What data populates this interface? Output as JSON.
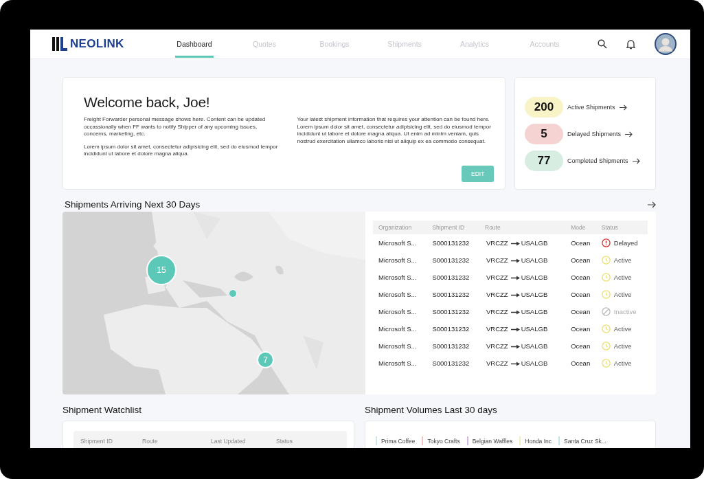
{
  "logo": {
    "text": "NEOLINK"
  },
  "nav": {
    "tabs": [
      {
        "label": "Dashboard",
        "selected": true
      },
      {
        "label": "Quotes",
        "selected": false
      },
      {
        "label": "Bookings",
        "selected": false
      },
      {
        "label": "Shipments",
        "selected": false
      },
      {
        "label": "Analytics",
        "selected": false
      },
      {
        "label": "Accounts",
        "selected": false
      }
    ]
  },
  "welcome": {
    "title": "Welcome back, Joe!",
    "paragraphs_left": [
      "Freight Forwarder personal message shows here. Content can be updated occassionally when FF wants to notify Shipper of any upcoming issues, concerns, marketing, etc.",
      "Lorem ipsum dolor sit amet, consectetur adipisicing elit, sed do eiusmod tempor incididunt ut labore et dolore magna aliqua."
    ],
    "paragraph_right": "Your latest shipment information that requires your attention can be found here. Lorem ipsum dolor sit amet, consectetur adipisicing elit, sed do eiusmod tempor incididunt ut labore et dolore magna aliqua. Ut enim ad minim veniam, quis nostrud exercitation ullamco laboris nisi ut aliquip ex ea commodo consequat.",
    "button": "EDIT"
  },
  "stats": [
    {
      "count": "200",
      "label": "Active Shipments",
      "color": "#f8f4c8"
    },
    {
      "count": "5",
      "label": "Delayed Shipments",
      "color": "#f6d3d3"
    },
    {
      "count": "77",
      "label": "Completed Shipments",
      "color": "#d8ede1"
    }
  ],
  "arrivals": {
    "title": "Shipments Arriving Next 30 Days",
    "map": {
      "markers": [
        {
          "label": "15",
          "kind": "cluster"
        },
        {
          "kind": "point"
        },
        {
          "label": "7",
          "kind": "cluster"
        }
      ]
    },
    "table": {
      "columns": [
        "Organization",
        "Shipment ID",
        "Route",
        "Mode",
        "Status"
      ],
      "rows": [
        {
          "organization": "Microsoft S...",
          "shipment_id": "S000131232",
          "origin": "VRCZZ",
          "destination": "USALGB",
          "mode": "Ocean",
          "status": "Delayed",
          "kind": "delayed"
        },
        {
          "organization": "Microsoft S...",
          "shipment_id": "S000131232",
          "origin": "VRCZZ",
          "destination": "USALGB",
          "mode": "Ocean",
          "status": "Active",
          "kind": "active"
        },
        {
          "organization": "Microsoft S...",
          "shipment_id": "S000131232",
          "origin": "VRCZZ",
          "destination": "USALGB",
          "mode": "Ocean",
          "status": "Active",
          "kind": "active"
        },
        {
          "organization": "Microsoft S...",
          "shipment_id": "S000131232",
          "origin": "VRCZZ",
          "destination": "USALGB",
          "mode": "Ocean",
          "status": "Active",
          "kind": "active"
        },
        {
          "organization": "Microsoft S...",
          "shipment_id": "S000131232",
          "origin": "VRCZZ",
          "destination": "USALGB",
          "mode": "Ocean",
          "status": "Inactive",
          "kind": "inactive"
        },
        {
          "organization": "Microsoft S...",
          "shipment_id": "S000131232",
          "origin": "VRCZZ",
          "destination": "USALGB",
          "mode": "Ocean",
          "status": "Active",
          "kind": "active"
        },
        {
          "organization": "Microsoft S...",
          "shipment_id": "S000131232",
          "origin": "VRCZZ",
          "destination": "USALGB",
          "mode": "Ocean",
          "status": "Active",
          "kind": "active"
        },
        {
          "organization": "Microsoft S...",
          "shipment_id": "S000131232",
          "origin": "VRCZZ",
          "destination": "USALGB",
          "mode": "Ocean",
          "status": "Active",
          "kind": "active"
        }
      ]
    }
  },
  "watchlist": {
    "title": "Shipment Watchlist",
    "columns": [
      "Shipment ID",
      "Route",
      "Last Updated",
      "Status"
    ]
  },
  "volumes": {
    "title": "Shipment Volumes Last 30 days",
    "legend": [
      {
        "label": "Prima Coffee",
        "color": "#cfe8dc"
      },
      {
        "label": "Tokyo Crafts",
        "color": "#f3c4c4"
      },
      {
        "label": "Belgian Waffles",
        "color": "#d6b6e8"
      },
      {
        "label": "Honda Inc",
        "color": "#f5ecc0"
      },
      {
        "label": "Santa Cruz Sk...",
        "color": "#c6e6e6"
      }
    ]
  }
}
